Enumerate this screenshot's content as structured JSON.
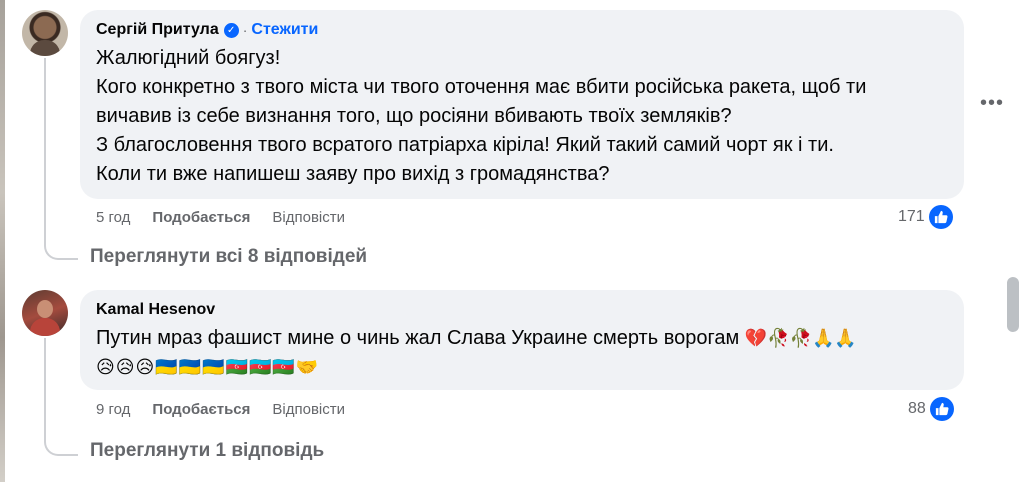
{
  "comments": [
    {
      "author": "Сергій Притула",
      "verified": true,
      "follow_label": "Стежити",
      "separator": "·",
      "lines": [
        "Жалюгідний боягуз!",
        "Кого конкретно з твого міста чи твого оточення має вбити російська ракета, щоб ти",
        "вичавив із себе визнання того, що росіяни вбивають твоїх земляків?",
        "З благословення твого всратого патріарха кіріла! Який такий самий чорт як і ти.",
        "Коли ти вже напишеш заяву про вихід з громадянства?"
      ],
      "time": "5 год",
      "like_label": "Подобається",
      "reply_label": "Відповісти",
      "reaction_count": "171",
      "view_replies": "Переглянути всі 8 відповідей"
    },
    {
      "author": "Kamal Hesenov",
      "text": "Путин мраз фашист мине о чинь жал Слава Украине смерть ворогам",
      "emoji_inline": "💔🥀🥀🙏🙏",
      "emoji_line": "😥😥😥🇺🇦🇺🇦🇺🇦🇦🇿🇦🇿🇦🇿🤝",
      "time": "9 год",
      "like_label": "Подобається",
      "reply_label": "Відповісти",
      "reaction_count": "88",
      "view_replies": "Переглянути 1 відповідь"
    }
  ],
  "icons": {
    "verified": "verified-check-icon",
    "like": "thumbs-up-icon",
    "more": "more-options-icon"
  },
  "colors": {
    "accent": "#0866ff",
    "bubble": "#f0f2f5",
    "muted": "#65676b"
  }
}
